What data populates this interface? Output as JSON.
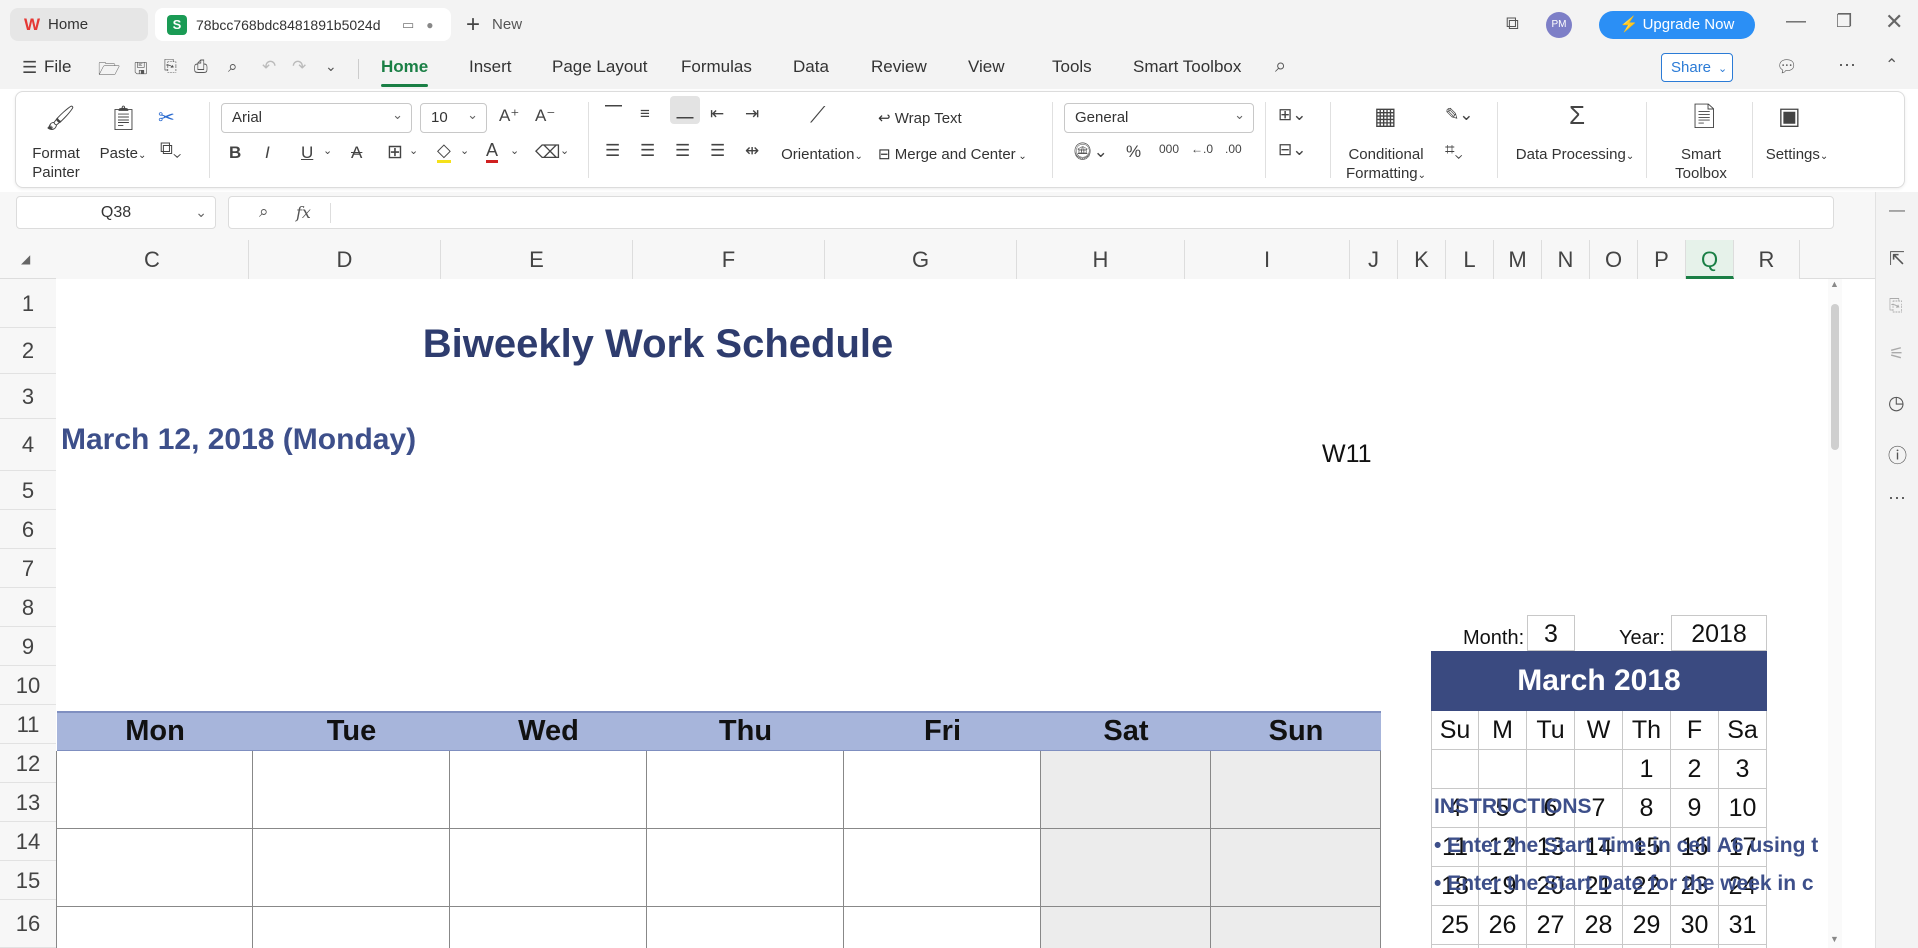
{
  "tabs": {
    "home": "Home",
    "file": "78bcc768bdc8481891b5024d",
    "new": "New"
  },
  "titlebar": {
    "avatar": "PM",
    "upgrade": "Upgrade Now"
  },
  "menu": {
    "file": "File",
    "items": [
      "Home",
      "Insert",
      "Page Layout",
      "Formulas",
      "Data",
      "Review",
      "View",
      "Tools",
      "Smart Toolbox"
    ],
    "share": "Share"
  },
  "ribbon": {
    "format_painter": [
      "Format",
      "Painter"
    ],
    "paste": "Paste",
    "font": "Arial",
    "font_size": "10",
    "wrap_text": "Wrap Text",
    "orientation": "Orientation",
    "merge_center": "Merge and Center",
    "number_format": "General",
    "conditional": [
      "Conditional",
      "Formatting"
    ],
    "data_processing": "Data Processing",
    "smart_toolbox": [
      "Smart",
      "Toolbox"
    ],
    "settings": "Settings"
  },
  "formula": {
    "cell_ref": "Q38",
    "fx": "fx",
    "value": ""
  },
  "columns": [
    "C",
    "D",
    "E",
    "F",
    "G",
    "H",
    "I",
    "J",
    "K",
    "L",
    "M",
    "N",
    "O",
    "P",
    "Q",
    "R"
  ],
  "rows": [
    "1",
    "2",
    "3",
    "4",
    "5",
    "6",
    "7",
    "8",
    "9",
    "10",
    "11",
    "12",
    "13",
    "14",
    "15",
    "16"
  ],
  "sheet": {
    "title": "Biweekly Work Schedule",
    "date_heading": "March 12, 2018 (Monday)",
    "week": "W11",
    "days": [
      "Mon",
      "Tue",
      "Wed",
      "Thu",
      "Fri",
      "Sat",
      "Sun"
    ],
    "month_label": "Month:",
    "month_value": "3",
    "year_label": "Year:",
    "year_value": "2018",
    "calendar_title": "March 2018",
    "calendar_days": [
      "Su",
      "M",
      "Tu",
      "W",
      "Th",
      "F",
      "Sa"
    ],
    "calendar_weeks": [
      [
        "",
        "",
        "",
        "",
        "1",
        "2",
        "3"
      ],
      [
        "4",
        "5",
        "6",
        "7",
        "8",
        "9",
        "10"
      ],
      [
        "11",
        "12",
        "13",
        "14",
        "15",
        "16",
        "17"
      ],
      [
        "18",
        "19",
        "20",
        "21",
        "22",
        "23",
        "24"
      ],
      [
        "25",
        "26",
        "27",
        "28",
        "29",
        "30",
        "31"
      ],
      [
        "",
        "",
        "",
        "",
        "",
        "",
        ""
      ]
    ],
    "instructions_title": "INSTRUCTIONS",
    "instructions": [
      "• Enter the Start Time in cell A6 using t",
      "• Enter the Start Date for the week in c"
    ]
  },
  "colors": {
    "accent_green": "#1a7f45",
    "title_navy": "#2e3c6e",
    "day_header_bg": "#a7b5db",
    "calendar_header_bg": "#3a4a80",
    "upgrade_blue": "#2b8ff5",
    "weekend_bg": "#ececec"
  }
}
